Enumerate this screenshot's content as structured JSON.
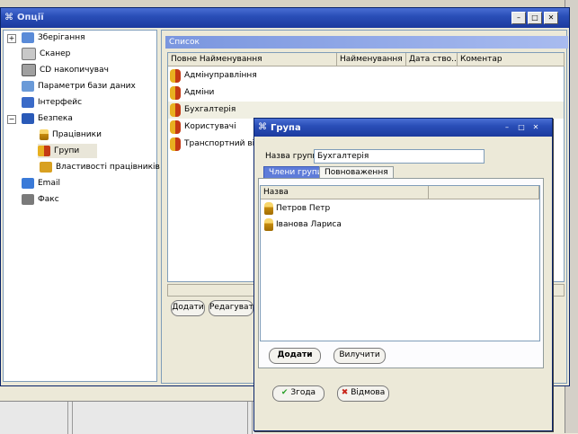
{
  "main_window": {
    "title": "Опції",
    "min": "–",
    "max": "□",
    "close": "✕"
  },
  "tree": {
    "items": [
      {
        "label": "Зберігання",
        "expander": "+"
      },
      {
        "label": "Сканер"
      },
      {
        "label": "CD накопичувач"
      },
      {
        "label": "Параметри бази даних"
      },
      {
        "label": "Інтерфейс"
      },
      {
        "label": "Безпека",
        "expander": "−"
      },
      {
        "label": "Працівники"
      },
      {
        "label": "Групи"
      },
      {
        "label": "Властивості працівників"
      },
      {
        "label": "Email"
      },
      {
        "label": "Факс"
      }
    ]
  },
  "list_panel": {
    "header": "Список",
    "columns": [
      "Повне Найменування",
      "Найменування",
      "Дата ство...",
      "Коментар"
    ],
    "rows": [
      "Адмінуправління",
      "Адміни",
      "Бухгалтерія",
      "Користувачі",
      "Транспортний відді..."
    ],
    "add_button": "Додати",
    "edit_button": "Редагувати"
  },
  "dialog": {
    "title": "Група",
    "group_name_label": "Назва групи",
    "group_name_value": "Бухгалтерія",
    "tabs": [
      "Члени групи",
      "Повноваження"
    ],
    "members_column": "Назва",
    "members": [
      "Петров Петр",
      "Іванова Лариса"
    ],
    "add_button": "Додати",
    "remove_button": "Вилучити",
    "ok_button": "Згода",
    "cancel_button": "Відмова",
    "min": "–",
    "max": "□",
    "close": "✕"
  }
}
